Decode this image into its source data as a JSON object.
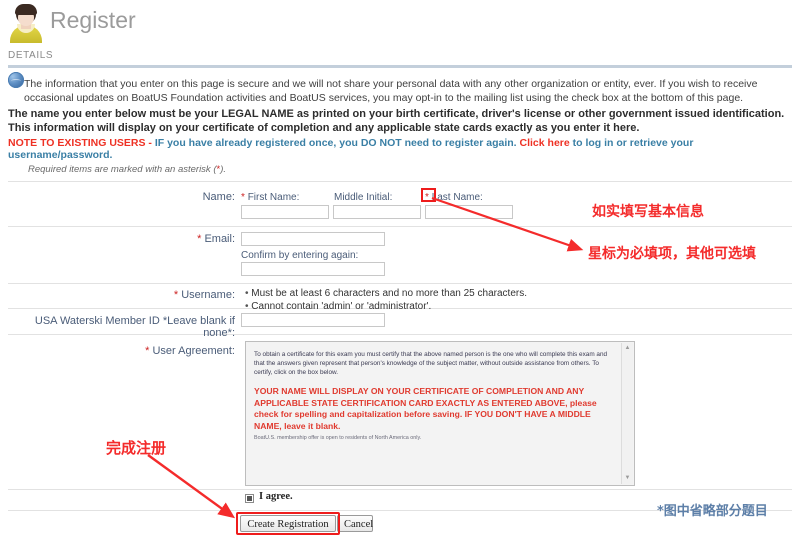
{
  "header": {
    "title": "Register",
    "avatar_icon": "user-avatar-icon",
    "section_label": "DETAILS"
  },
  "intro": {
    "info_icon": "globe-info-icon",
    "privacy_text": "The information that you enter on this page is secure and we will not share your personal data with any other organization or entity, ever. If you wish to receive occasional updates on BoatUS Foundation activities and BoatUS services, you may opt-in to the mailing list using the check box at the bottom of this page.",
    "legal_name_text": "The name you enter below must be your LEGAL NAME as printed on your birth certificate, driver's license or other government issued identification. This information will display on your certificate of completion and any applicable state cards exactly as you enter it here.",
    "note_prefix": "NOTE TO EXISTING USERS - ",
    "note_body_1": "IF you have already registered once, you DO NOT need to register again. ",
    "note_link": "Click here",
    "note_body_2": " to log in or retrieve your username/password.",
    "required_note_pre": "Required items are marked with an asterisk (",
    "required_note_ast": "*",
    "required_note_post": ")."
  },
  "form": {
    "name_label": "Name:",
    "first_name_label": "First Name:",
    "middle_initial_label": "Middle Initial:",
    "last_name_label": "Last Name:",
    "first_name_value": "",
    "middle_initial_value": "",
    "last_name_value": "",
    "email_label": "Email:",
    "email_value": "",
    "email_confirm_label": "Confirm by entering again:",
    "email_confirm_value": "",
    "username_label": "Username:",
    "username_rule_1": "Must be at least 6 characters and no more than 25 characters.",
    "username_rule_2": "Cannot contain 'admin' or 'administrator'.",
    "member_id_label": "USA Waterski Member ID *Leave blank if none*:",
    "member_id_value": "",
    "user_agreement_label": "User Agreement:",
    "asterisk": "*"
  },
  "agreement": {
    "paragraph": "To obtain a certificate for this exam you must certify that the above named person is the one who will complete this exam and that the answers given represent that person's knowledge of the subject matter, without outside assistance from others. To certify, click on the box below.",
    "warning": "YOUR NAME WILL DISPLAY ON YOUR CERTIFICATE OF COMPLETION AND ANY APPLICABLE STATE CERTIFICATION CARD EXACTLY AS ENTERED ABOVE, please check for spelling and capitalization before saving. IF YOU DON'T HAVE A MIDDLE NAME, leave it blank.",
    "footnote": "BoatU.S. membership offer is open to residents of North America only.",
    "scroll_up_icon": "scroll-up-arrow-icon",
    "scroll_down_icon": "scroll-down-arrow-icon"
  },
  "footer": {
    "agree_checkbox_label": "I agree.",
    "agree_checked": true,
    "create_button": "Create Registration",
    "cancel_button": "Cancel"
  },
  "annotations": {
    "fill_basic_info": "如实填写基本信息",
    "asterisk_required": "星标为必填项，其他可选填",
    "complete_registration": "完成注册",
    "omitted_questions": "*图中省略部分题目",
    "red": "#f42b2b",
    "blue_gray": "#5d7fa8"
  }
}
